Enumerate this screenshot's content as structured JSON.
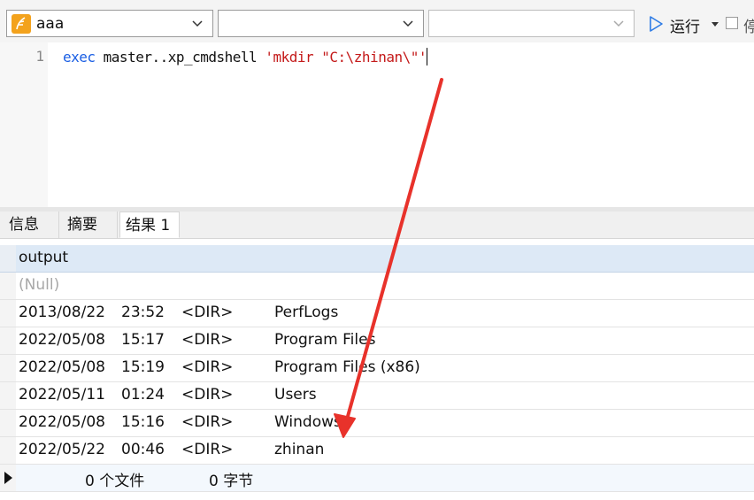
{
  "toolbar": {
    "connection_value": "aaa",
    "database_value": "",
    "schema_value": "",
    "run_label": "运行",
    "option_label": "停"
  },
  "editor": {
    "line_number": "1",
    "code": {
      "keyword": "exec",
      "object": " master..xp_cmdshell ",
      "string": "'mkdir \"C:\\zhinan\\\"'"
    }
  },
  "tabs": [
    {
      "label": "信息"
    },
    {
      "label": "摘要"
    },
    {
      "label": "结果 1"
    }
  ],
  "grid": {
    "column_header": "output",
    "null_value": "(Null)",
    "rows": [
      {
        "date": "2013/08/22",
        "time": "23:52",
        "type": "<DIR>",
        "name": "PerfLogs"
      },
      {
        "date": "2022/05/08",
        "time": "15:17",
        "type": "<DIR>",
        "name": "Program Files"
      },
      {
        "date": "2022/05/08",
        "time": "15:19",
        "type": "<DIR>",
        "name": "Program Files (x86)"
      },
      {
        "date": "2022/05/11",
        "time": "01:24",
        "type": "<DIR>",
        "name": "Users"
      },
      {
        "date": "2022/05/08",
        "time": "15:16",
        "type": "<DIR>",
        "name": "Windows"
      },
      {
        "date": "2022/05/22",
        "time": "00:46",
        "type": "<DIR>",
        "name": "zhinan"
      }
    ],
    "summary": {
      "files": "0 个文件",
      "bytes": "0 字节"
    }
  },
  "colors": {
    "keyword": "#1a5ee3",
    "string": "#c41a1a",
    "header_bg": "#dde9f6",
    "annotation_arrow": "#e8322b",
    "run_icon": "#2d7be5"
  },
  "icons": {
    "connection": "database-icon",
    "run": "play-icon",
    "dropdown": "chevron-down-icon"
  }
}
